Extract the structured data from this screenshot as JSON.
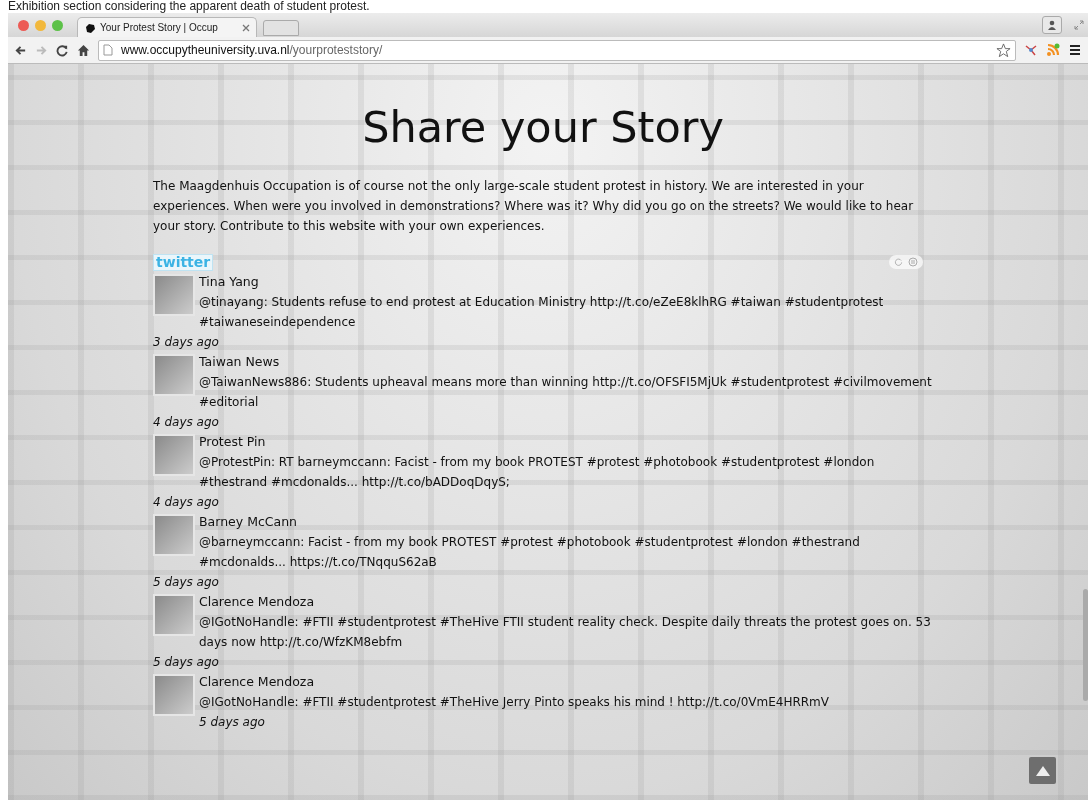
{
  "caption": "Exhibition section considering the apparent death of student protest.",
  "browser": {
    "tab_title": "Your Protest Story | Occup",
    "url_host": "www.occupytheuniversity.uva.nl",
    "url_path": "/yourproteststory/"
  },
  "page": {
    "title": "Share your Story",
    "intro": "The Maagdenhuis Occupation is of course not the only large-scale student protest in history. We are interested in your experiences. When were you involved in demonstrations? Where was it? Why did you go on the streets? We would like to hear your story. Contribute to this website with your own experiences.",
    "widget_logo": "twitter",
    "tweets": [
      {
        "name": "Tina Yang",
        "text": "@tinayang: Students refuse to end protest at Education Ministry http://t.co/eZeE8klhRG #taiwan #studentprotest #taiwaneseindependence",
        "time": "3 days ago",
        "time_indented": false
      },
      {
        "name": "Taiwan News",
        "text": "@TaiwanNews886: Students upheaval means more than winning http://t.co/OFSFI5MjUk #studentprotest #civilmovement #editorial",
        "time": "4 days ago",
        "time_indented": false
      },
      {
        "name": "Protest Pin",
        "text": "@ProtestPin: RT barneymccann: Facist - from my book PROTEST #protest #photobook #studentprotest #london #thestrand #mcdonalds... http://t.co/bADDoqDqyS;",
        "time": "4 days ago",
        "time_indented": false
      },
      {
        "name": "Barney McCann",
        "text": "@barneymccann: Facist - from my book PROTEST #protest #photobook #studentprotest #london #thestrand #mcdonalds... https://t.co/TNqquS62aB",
        "time": "5 days ago",
        "time_indented": false
      },
      {
        "name": "Clarence Mendoza",
        "text": "@IGotNoHandle: #FTII #studentprotest #TheHive FTII student reality check. Despite daily threats the protest goes on. 53 days now http://t.co/WfzKM8ebfm",
        "time": "5 days ago",
        "time_indented": false
      },
      {
        "name": "Clarence Mendoza",
        "text": "@IGotNoHandle: #FTII #studentprotest #TheHive Jerry Pinto speaks his mind ! http://t.co/0VmE4HRRmV",
        "time": "5 days ago",
        "time_indented": true
      }
    ]
  }
}
